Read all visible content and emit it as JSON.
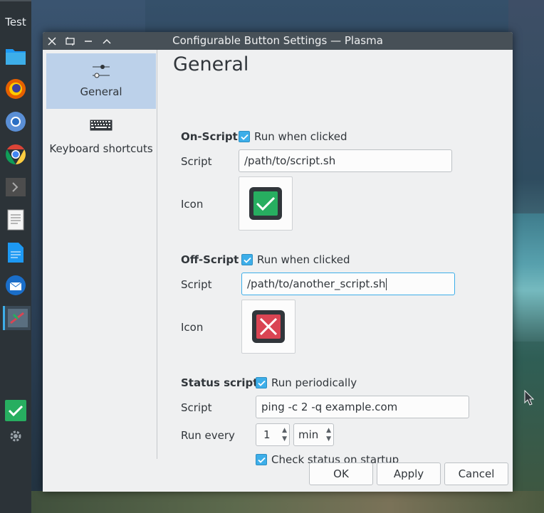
{
  "taskbar": {
    "title": "Test",
    "icons": [
      "folder-icon",
      "firefox-icon",
      "chromium-icon",
      "chrome-icon",
      "terminal-icon",
      "text-editor-icon",
      "document-icon",
      "thunderbird-icon",
      "kdevelop-icon",
      "checkmark-app-icon",
      "settings-gear-icon"
    ]
  },
  "window": {
    "title": "Configurable Button Settings — Plasma"
  },
  "sidebar": {
    "items": [
      {
        "label": "General",
        "icon": "sliders-icon"
      },
      {
        "label": "Keyboard shortcuts",
        "icon": "keyboard-icon"
      }
    ]
  },
  "content": {
    "heading": "General",
    "on_script": {
      "label": "On-Script",
      "checkbox": "Run when clicked",
      "checked": true,
      "script_label": "Script",
      "script_value": "/path/to/script.sh",
      "icon_label": "Icon",
      "icon": "checkmark-icon"
    },
    "off_script": {
      "label": "Off-Script",
      "checkbox": "Run when clicked",
      "checked": true,
      "script_label": "Script",
      "script_value": "/path/to/another_script.sh",
      "icon_label": "Icon",
      "icon": "cross-icon"
    },
    "status_script": {
      "label": "Status script",
      "checkbox": "Run periodically",
      "checked": true,
      "script_label": "Script",
      "script_value": "ping -c 2 -q example.com",
      "run_every_label": "Run every",
      "interval": "1",
      "unit": "min",
      "startup_checkbox": "Check status on startup",
      "startup_checked": true
    }
  },
  "buttons": {
    "ok": "OK",
    "apply": "Apply",
    "cancel": "Cancel"
  },
  "colors": {
    "accent": "#3daee9",
    "titlebar": "#475057",
    "selection": "#bcd1ea",
    "check_green": "#27ae60",
    "cross_red": "#da4453"
  }
}
